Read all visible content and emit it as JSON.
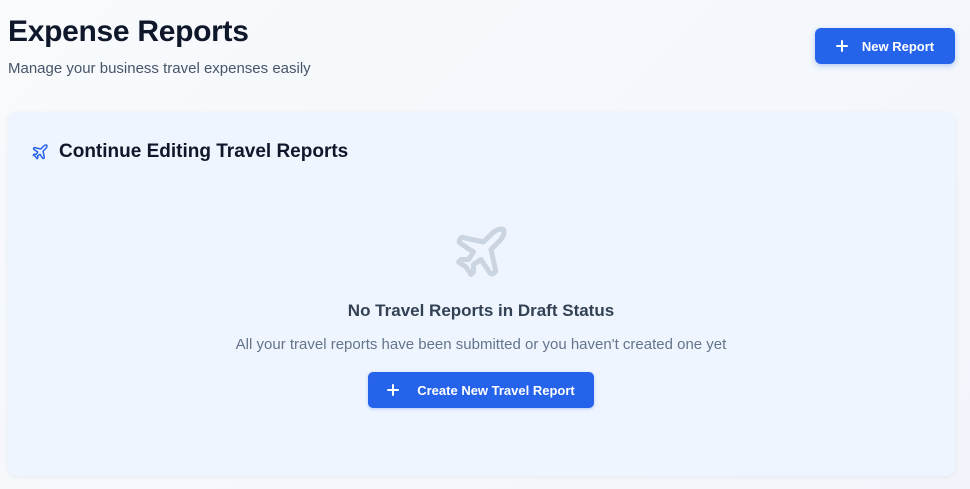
{
  "header": {
    "title": "Expense Reports",
    "subtitle": "Manage your business travel expenses easily",
    "new_report_label": "New Report",
    "new_report_icon": "plus-icon"
  },
  "drafts": {
    "title": "Continue Editing Travel Reports",
    "title_icon": "plane-icon",
    "empty": {
      "icon": "plane-icon",
      "title": "No Travel Reports in Draft Status",
      "description": "All your travel reports have been submitted or you haven't created one yet",
      "create_label": "Create New Travel Report",
      "create_icon": "plus-icon"
    }
  },
  "colors": {
    "primary": "#2563eb",
    "title_text": "#0f172a",
    "muted_text": "#64748b",
    "card_background": "#eff5fe",
    "empty_icon": "#cbd5e1"
  }
}
